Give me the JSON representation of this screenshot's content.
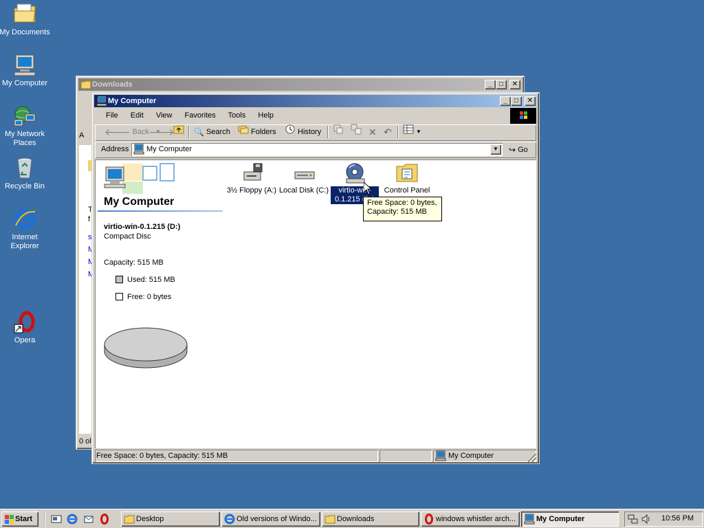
{
  "desktop": {
    "icons": [
      {
        "label": "My Documents",
        "icon": "folder-documents-icon"
      },
      {
        "label": "My Computer",
        "icon": "computer-icon"
      },
      {
        "label": "My Network Places",
        "icon": "network-icon"
      },
      {
        "label": "Recycle Bin",
        "icon": "recycle-bin-icon"
      },
      {
        "label": "Internet Explorer",
        "icon": "internet-explorer-icon"
      },
      {
        "label": "Opera",
        "icon": "opera-icon"
      }
    ]
  },
  "downloads_window": {
    "title": "Downloads",
    "partial_texts": [
      "A",
      "T",
      "f",
      "s",
      "M",
      "M",
      "M",
      "0 ol"
    ]
  },
  "mycomputer_window": {
    "title": "My Computer",
    "menu": [
      "File",
      "Edit",
      "View",
      "Favorites",
      "Tools",
      "Help"
    ],
    "toolbar": {
      "back": "Back",
      "search": "Search",
      "folders": "Folders",
      "history": "History"
    },
    "address": {
      "label": "Address",
      "value": "My Computer",
      "go": "Go"
    },
    "left_panel": {
      "heading": "My Computer",
      "item_title": "virtio-win-0.1.215 (D:)",
      "item_type": "Compact Disc",
      "capacity": "Capacity: 515 MB",
      "used": "Used: 515 MB",
      "free": "Free: 0 bytes"
    },
    "drives": [
      {
        "label": "3½ Floppy (A:)",
        "icon": "floppy-drive-icon"
      },
      {
        "label": "Local Disk (C:)",
        "icon": "hard-disk-icon"
      },
      {
        "label": "virtio-win-0.1.215 (D:)",
        "icon": "cd-drive-icon",
        "selected": true
      },
      {
        "label": "Control Panel",
        "icon": "control-panel-icon"
      }
    ],
    "tooltip": {
      "line1": "Free Space: 0 bytes,",
      "line2": "Capacity: 515 MB"
    },
    "statusbar": {
      "left": "Free Space: 0 bytes, Capacity: 515 MB",
      "right": "My Computer"
    }
  },
  "taskbar": {
    "start": "Start",
    "tasks": [
      {
        "label": "Desktop",
        "icon": "folder-icon"
      },
      {
        "label": "Old versions of Windo...",
        "icon": "internet-explorer-icon"
      },
      {
        "label": "Downloads",
        "icon": "folder-icon"
      },
      {
        "label": "windows whistler arch...",
        "icon": "opera-icon"
      },
      {
        "label": "My Computer",
        "icon": "computer-icon",
        "active": true
      }
    ],
    "clock": "10:56 PM"
  },
  "colors": {
    "desktop": "#3a6ea5",
    "title_active": "#0a246a",
    "face": "#d4d0c8",
    "selection": "#0a246a",
    "tooltip": "#ffffe1"
  }
}
